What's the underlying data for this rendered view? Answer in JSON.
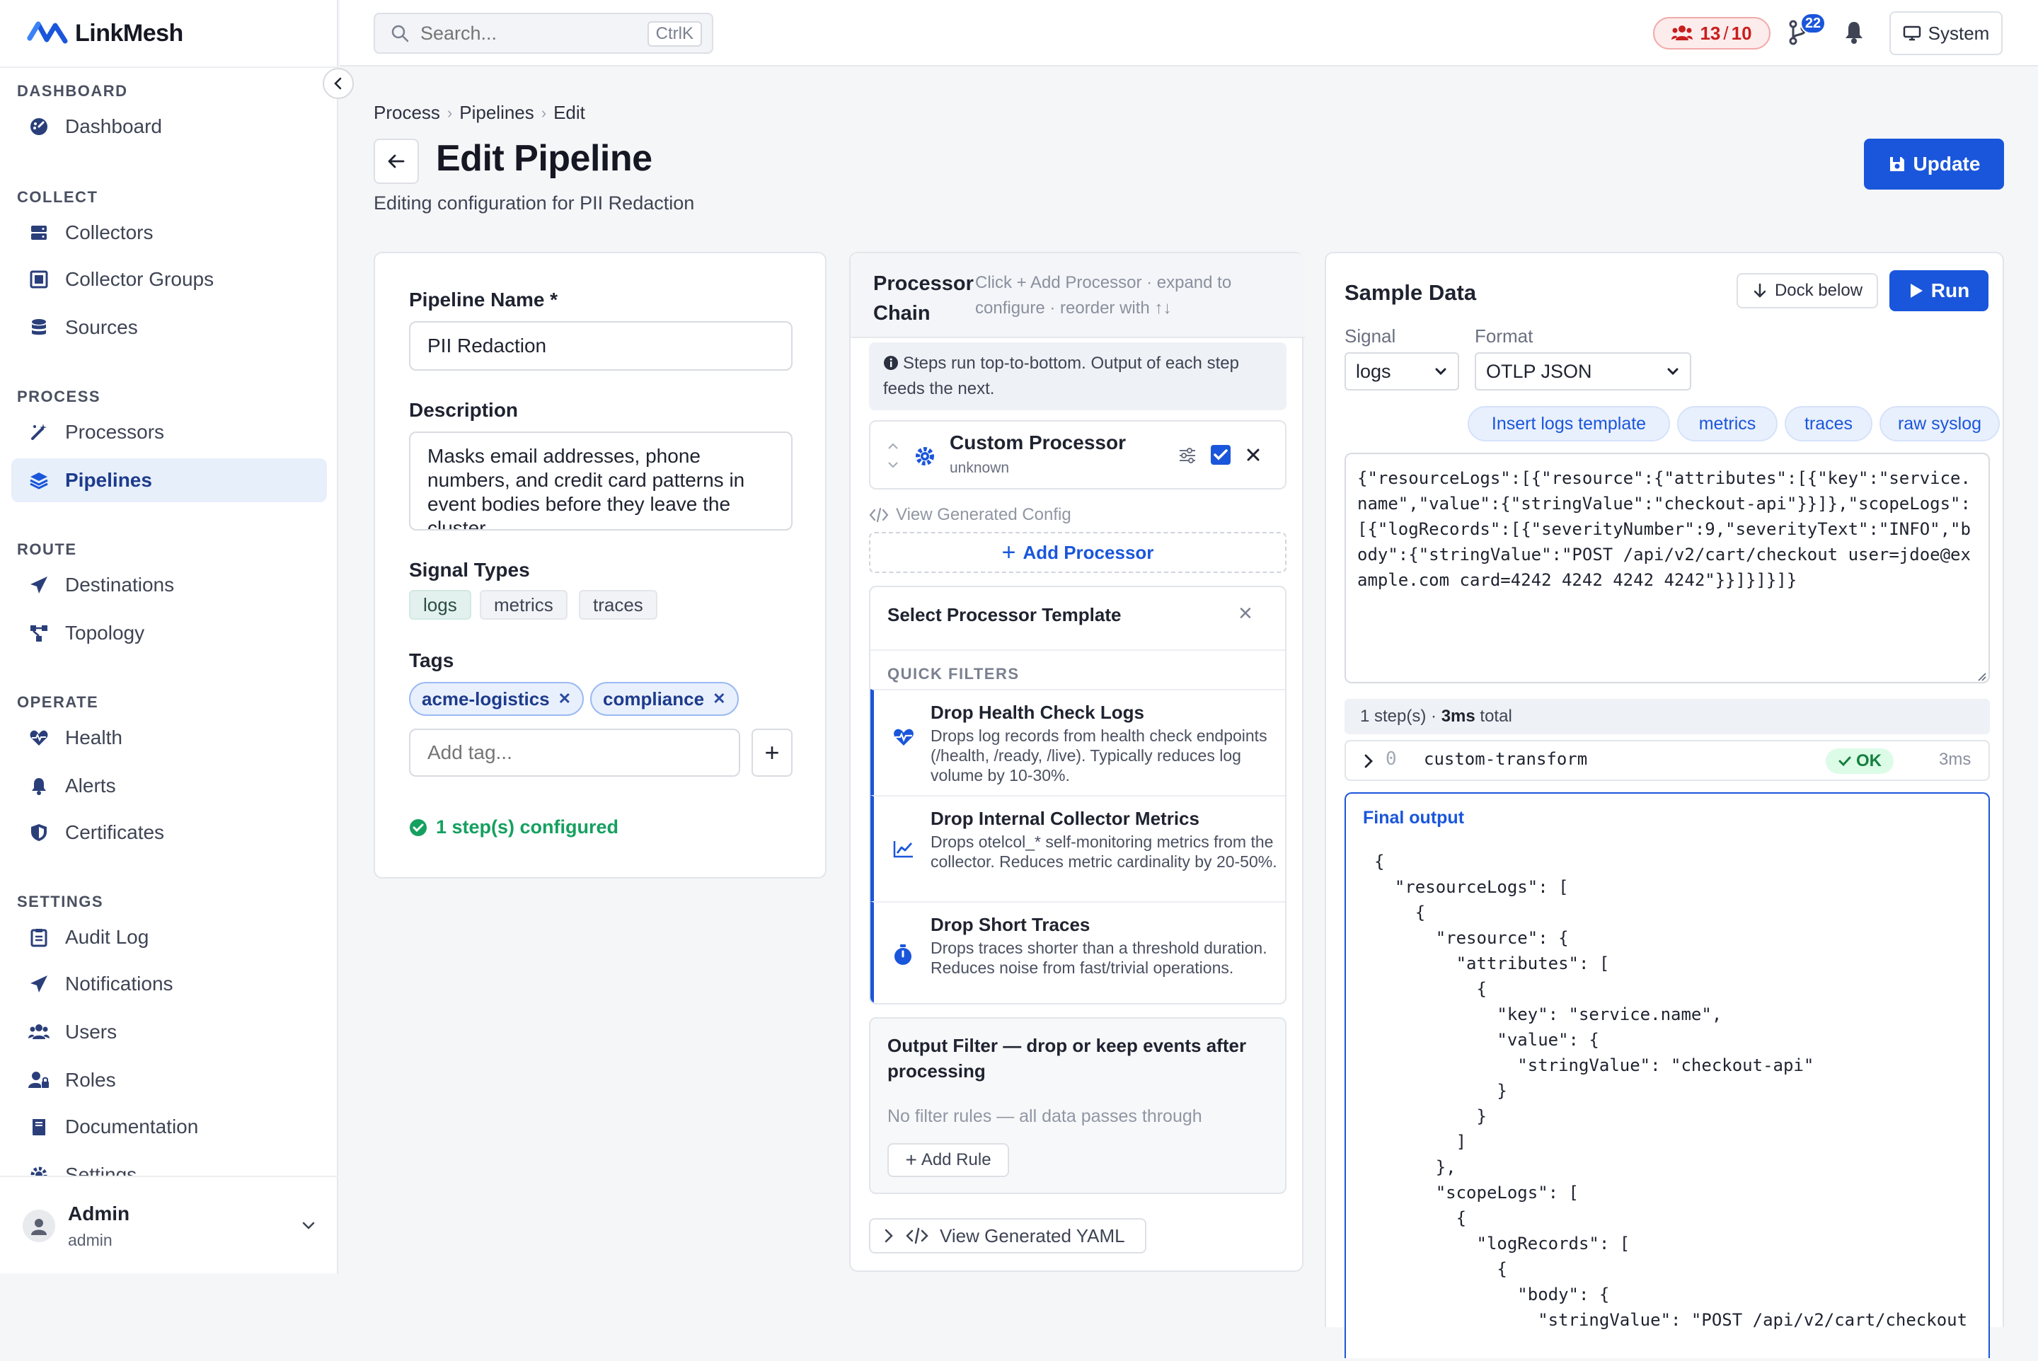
{
  "app": {
    "name": "LinkMesh"
  },
  "sidebar": {
    "sections": {
      "dashboard": "DASHBOARD",
      "collect": "COLLECT",
      "process": "PROCESS",
      "route": "ROUTE",
      "operate": "OPERATE",
      "settings": "SETTINGS"
    },
    "items": {
      "dashboard": "Dashboard",
      "collectors": "Collectors",
      "collector_groups": "Collector Groups",
      "sources": "Sources",
      "processors": "Processors",
      "pipelines": "Pipelines",
      "destinations": "Destinations",
      "topology": "Topology",
      "health": "Health",
      "alerts": "Alerts",
      "certificates": "Certificates",
      "audit_log": "Audit Log",
      "notifications": "Notifications",
      "users": "Users",
      "roles": "Roles",
      "documentation": "Documentation",
      "settings": "Settings"
    },
    "active": "pipelines",
    "user": {
      "name": "Admin",
      "role": "admin"
    }
  },
  "topbar": {
    "search_placeholder": "Search...",
    "search_shortcut": "CtrlK",
    "limit_used": "13",
    "limit_sep": "/",
    "limit_total": "10",
    "git_count": "22",
    "theme_label": "System"
  },
  "header": {
    "breadcrumb": [
      "Process",
      "Pipelines",
      "Edit"
    ],
    "title": "Edit Pipeline",
    "subtitle": "Editing configuration for PII Redaction",
    "update_label": "Update"
  },
  "form": {
    "name_label": "Pipeline Name *",
    "name_value": "PII Redaction",
    "description_label": "Description",
    "description_value": "Masks email addresses, phone numbers, and credit card patterns in event bodies before they leave the cluster.",
    "signal_label": "Signal Types",
    "signals": [
      "logs",
      "metrics",
      "traces"
    ],
    "tags_label": "Tags",
    "tags": [
      "acme-logistics",
      "compliance"
    ],
    "tag_placeholder": "Add tag...",
    "add_tag_symbol": "+",
    "steps_configured": "1 step(s) configured"
  },
  "chain": {
    "title": "Processor Chain",
    "hint": "Click + Add Processor · expand to configure · reorder with ↑↓",
    "info": "Steps run top-to-bottom. Output of each step feeds the next.",
    "processor": {
      "name": "Custom Processor",
      "type": "unknown",
      "enabled": true
    },
    "view_config": "View Generated Config",
    "add_processor": "Add Processor",
    "template_title": "Select Processor Template",
    "quick_filters": "QUICK FILTERS",
    "templates": [
      {
        "name": "Drop Health Check Logs",
        "desc": "Drops log records from health check endpoints (/health, /ready, /live). Typically reduces log volume by 10-30%."
      },
      {
        "name": "Drop Internal Collector Metrics",
        "desc": "Drops otelcol_* self-monitoring metrics from the collector. Reduces metric cardinality by 20-50%."
      },
      {
        "name": "Drop Short Traces",
        "desc": "Drops traces shorter than a threshold duration. Reduces noise from fast/trivial operations."
      }
    ],
    "filter_title": "Output Filter — drop or keep events after processing",
    "filter_empty": "No filter rules — all data passes through",
    "add_rule": "Add Rule",
    "view_yaml": "View Generated YAML"
  },
  "sample": {
    "title": "Sample Data",
    "dock_label": "Dock below",
    "run_label": "Run",
    "signal_label": "Signal",
    "signal_value": "logs",
    "format_label": "Format",
    "format_value": "OTLP JSON",
    "pills": [
      "Insert logs template",
      "metrics",
      "traces",
      "raw syslog"
    ],
    "input": "{\"resourceLogs\":[{\"resource\":{\"attributes\":[{\"key\":\"service.name\",\"value\":{\"stringValue\":\"checkout-api\"}}]},\"scopeLogs\":[{\"logRecords\":[{\"severityNumber\":9,\"severityText\":\"INFO\",\"body\":{\"stringValue\":\"POST /api/v2/cart/checkout user=jdoe@example.com card=4242 4242 4242 4242\"}}]}]}]}",
    "summary_steps": "1 step(s) · ",
    "summary_ms": "3ms",
    "summary_total": " total",
    "step_index": "0",
    "step_name": "custom-transform",
    "step_status": "OK",
    "step_time": "3ms",
    "output_title": "Final output",
    "output": "{\n  \"resourceLogs\": [\n    {\n      \"resource\": {\n        \"attributes\": [\n          {\n            \"key\": \"service.name\",\n            \"value\": {\n              \"stringValue\": \"checkout-api\"\n            }\n          }\n        ]\n      },\n      \"scopeLogs\": [\n        {\n          \"logRecords\": [\n            {\n              \"body\": {\n                \"stringValue\": \"POST /api/v2/cart/checkout"
  },
  "colors": {
    "accent": "#1a56db",
    "danger": "#c81e1e",
    "success": "#15a060"
  }
}
